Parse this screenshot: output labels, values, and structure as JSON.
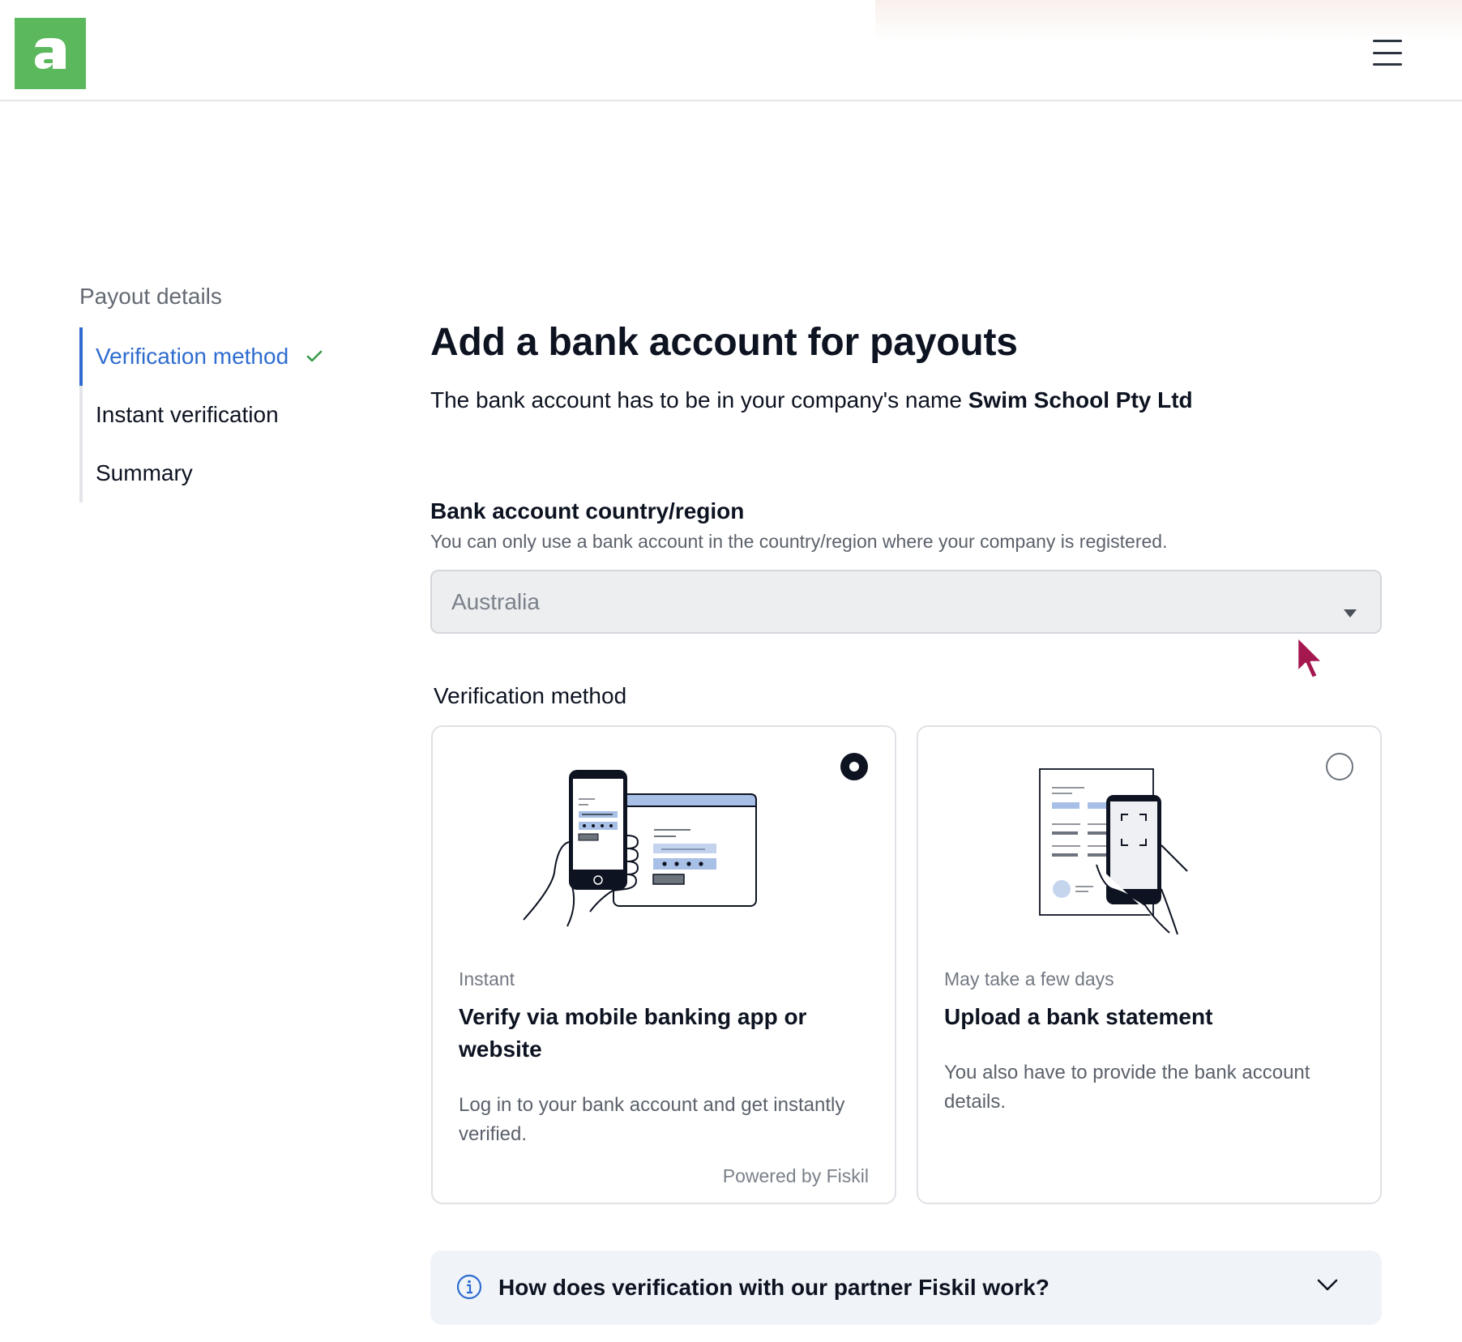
{
  "header": {
    "logo_letter": "a",
    "brand_color": "#5cb85c",
    "menu_icon": "hamburger-menu-icon"
  },
  "sidebar": {
    "title": "Payout details",
    "steps": [
      {
        "label": "Verification method",
        "status": "active-complete"
      },
      {
        "label": "Instant verification",
        "status": "pending"
      },
      {
        "label": "Summary",
        "status": "pending"
      }
    ],
    "accent_color": "#2e6ccf"
  },
  "main": {
    "title": "Add a bank account for payouts",
    "subtitle_prefix": "The bank account has to be in your company's name",
    "company_name": "Swim School Pty Ltd",
    "country_field": {
      "label": "Bank account country/region",
      "help": "You can only use a bank account in the country/region where your company is registered.",
      "value": "Australia",
      "disabled": true
    },
    "verification": {
      "label": "Verification method",
      "options": [
        {
          "eyebrow": "Instant",
          "title": "Verify via mobile banking app or website",
          "description": "Log in to your bank account and get instantly verified.",
          "footer": "Powered by Fiskil",
          "selected": true,
          "illustration": "phone-and-browser-illustration"
        },
        {
          "eyebrow": "May take a few days",
          "title": "Upload a bank statement",
          "description": "You also have to provide the bank account details.",
          "selected": false,
          "illustration": "phone-scanning-document-illustration"
        }
      ]
    },
    "faq": {
      "question": "How does verification with our partner Fiskil work?",
      "icon": "info-icon",
      "expanded": false
    }
  }
}
